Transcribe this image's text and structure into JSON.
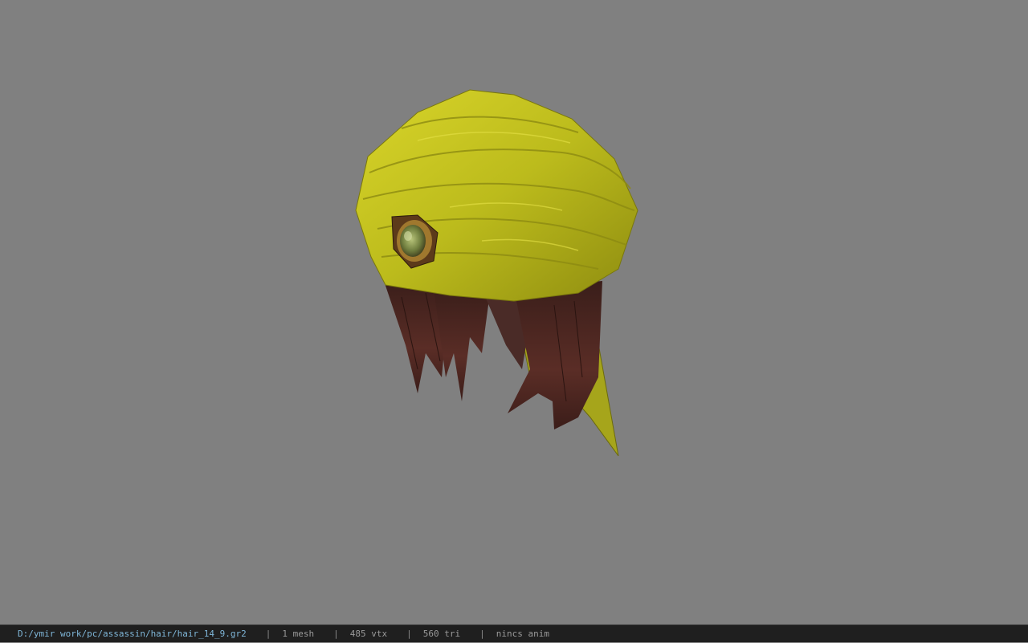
{
  "viewport": {
    "background_color": "#808080",
    "model": {
      "turban_color": "#c7c521",
      "hair_color": "#4a2620",
      "gem_color": "#8a9a55"
    }
  },
  "statusbar": {
    "file_path": "D:/ymir work/pc/assassin/hair/hair_14_9.gr2",
    "separator": "|",
    "mesh_count": "1 mesh",
    "vertex_count": "485 vtx",
    "triangle_count": "560 tri",
    "anim_status": "nincs anim",
    "path_color": "#7fb6d8"
  }
}
